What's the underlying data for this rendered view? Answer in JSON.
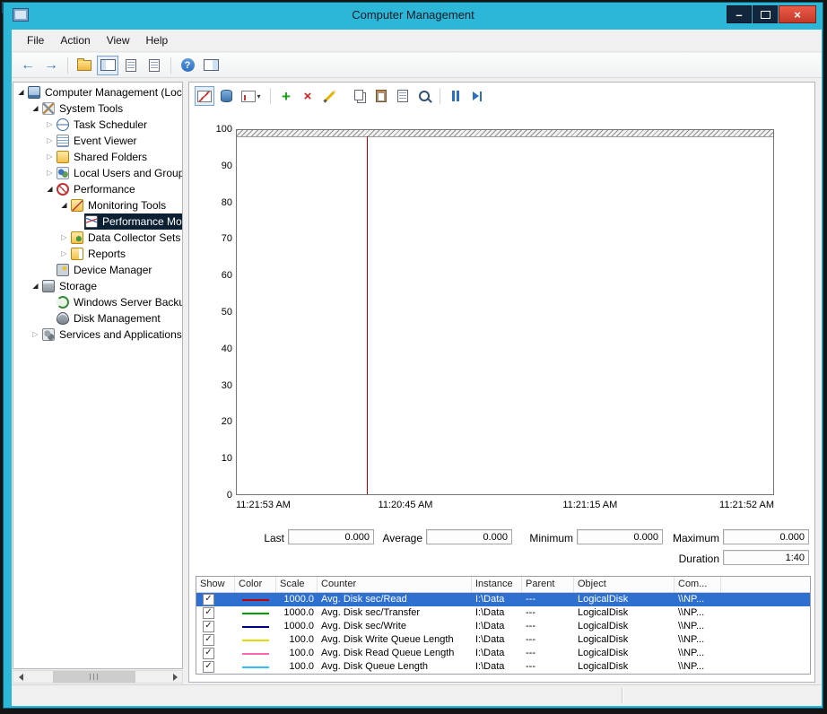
{
  "window": {
    "title": "Computer Management"
  },
  "glyphs": {
    "minimize": "–",
    "close": "×",
    "back": "←",
    "forward": "→",
    "help": "?",
    "add": "+",
    "delete": "×",
    "caret": "▾",
    "check": "✓",
    "expanded": "◢",
    "collapsed": "▷"
  },
  "menu": [
    "File",
    "Action",
    "View",
    "Help"
  ],
  "tree": {
    "items": [
      {
        "label": "Computer Management (Local",
        "level": 0,
        "expander": "expanded",
        "icon": "computer-icon",
        "selected": false
      },
      {
        "label": "System Tools",
        "level": 1,
        "expander": "expanded",
        "icon": "system-tools-icon",
        "selected": false
      },
      {
        "label": "Task Scheduler",
        "level": 2,
        "expander": "collapsed",
        "icon": "task-scheduler-icon",
        "selected": false
      },
      {
        "label": "Event Viewer",
        "level": 2,
        "expander": "collapsed",
        "icon": "event-viewer-icon",
        "selected": false
      },
      {
        "label": "Shared Folders",
        "level": 2,
        "expander": "collapsed",
        "icon": "shared-folders-icon",
        "selected": false
      },
      {
        "label": "Local Users and Groups",
        "level": 2,
        "expander": "collapsed",
        "icon": "users-icon",
        "selected": false
      },
      {
        "label": "Performance",
        "level": 2,
        "expander": "expanded",
        "icon": "performance-icon",
        "selected": false
      },
      {
        "label": "Monitoring Tools",
        "level": 3,
        "expander": "expanded",
        "icon": "monitoring-tools-icon",
        "selected": false
      },
      {
        "label": "Performance Mo",
        "level": 4,
        "expander": "none",
        "icon": "perfmon-icon",
        "selected": true
      },
      {
        "label": "Data Collector Sets",
        "level": 3,
        "expander": "collapsed",
        "icon": "data-collector-icon",
        "selected": false
      },
      {
        "label": "Reports",
        "level": 3,
        "expander": "collapsed",
        "icon": "reports-icon",
        "selected": false
      },
      {
        "label": "Device Manager",
        "level": 2,
        "expander": "none",
        "icon": "device-manager-icon",
        "selected": false
      },
      {
        "label": "Storage",
        "level": 1,
        "expander": "expanded",
        "icon": "storage-icon",
        "selected": false
      },
      {
        "label": "Windows Server Backup",
        "level": 2,
        "expander": "none",
        "icon": "backup-icon",
        "selected": false
      },
      {
        "label": "Disk Management",
        "level": 2,
        "expander": "none",
        "icon": "disk-management-icon",
        "selected": false
      },
      {
        "label": "Services and Applications",
        "level": 1,
        "expander": "collapsed",
        "icon": "services-icon",
        "selected": false
      }
    ]
  },
  "perfmon": {
    "stats": {
      "last_label": "Last",
      "last_value": "0.000",
      "average_label": "Average",
      "average_value": "0.000",
      "minimum_label": "Minimum",
      "minimum_value": "0.000",
      "maximum_label": "Maximum",
      "maximum_value": "0.000",
      "duration_label": "Duration",
      "duration_value": "1:40"
    },
    "table": {
      "columns": [
        "Show",
        "Color",
        "Scale",
        "Counter",
        "Instance",
        "Parent",
        "Object",
        "Com..."
      ],
      "rows": [
        {
          "checked": true,
          "color": "#c00000",
          "scale": "1000.0",
          "counter": "Avg. Disk sec/Read",
          "instance": "I:\\Data",
          "parent": "---",
          "object": "LogicalDisk",
          "computer": "\\\\NP...",
          "selected": true
        },
        {
          "checked": true,
          "color": "#00a000",
          "scale": "1000.0",
          "counter": "Avg. Disk sec/Transfer",
          "instance": "I:\\Data",
          "parent": "---",
          "object": "LogicalDisk",
          "computer": "\\\\NP...",
          "selected": false
        },
        {
          "checked": true,
          "color": "#000080",
          "scale": "1000.0",
          "counter": "Avg. Disk sec/Write",
          "instance": "I:\\Data",
          "parent": "---",
          "object": "LogicalDisk",
          "computer": "\\\\NP...",
          "selected": false
        },
        {
          "checked": true,
          "color": "#dede00",
          "scale": "100.0",
          "counter": "Avg. Disk Write Queue Length",
          "instance": "I:\\Data",
          "parent": "---",
          "object": "LogicalDisk",
          "computer": "\\\\NP...",
          "selected": false
        },
        {
          "checked": true,
          "color": "#ff66b0",
          "scale": "100.0",
          "counter": "Avg. Disk Read Queue Length",
          "instance": "I:\\Data",
          "parent": "---",
          "object": "LogicalDisk",
          "computer": "\\\\NP...",
          "selected": false
        },
        {
          "checked": true,
          "color": "#33bfff",
          "scale": "100.0",
          "counter": "Avg. Disk Queue Length",
          "instance": "I:\\Data",
          "parent": "---",
          "object": "LogicalDisk",
          "computer": "\\\\NP...",
          "selected": false
        }
      ]
    }
  },
  "chart_data": {
    "type": "line",
    "title": "",
    "xlabel": "",
    "ylabel": "",
    "ylim": [
      0,
      100
    ],
    "y_ticks": [
      100,
      90,
      80,
      70,
      60,
      50,
      40,
      30,
      20,
      10,
      0
    ],
    "x_ticks": [
      "11:21:53 AM",
      "11:20:45 AM",
      "11:21:15 AM",
      "11:21:52 AM"
    ],
    "grid": false,
    "legend_position": "table-below",
    "series": [
      {
        "name": "Avg. Disk sec/Read",
        "color": "#c00000",
        "values": []
      },
      {
        "name": "Avg. Disk sec/Transfer",
        "color": "#00a000",
        "values": []
      },
      {
        "name": "Avg. Disk sec/Write",
        "color": "#000080",
        "values": []
      },
      {
        "name": "Avg. Disk Write Queue Length",
        "color": "#dede00",
        "values": []
      },
      {
        "name": "Avg. Disk Read Queue Length",
        "color": "#ff66b0",
        "values": []
      },
      {
        "name": "Avg. Disk Queue Length",
        "color": "#33bfff",
        "values": []
      }
    ],
    "timeline_cursor_pct": 24.2,
    "note": "graph area is empty (all counter values 0.000); red vertical timeline cursor near left"
  }
}
